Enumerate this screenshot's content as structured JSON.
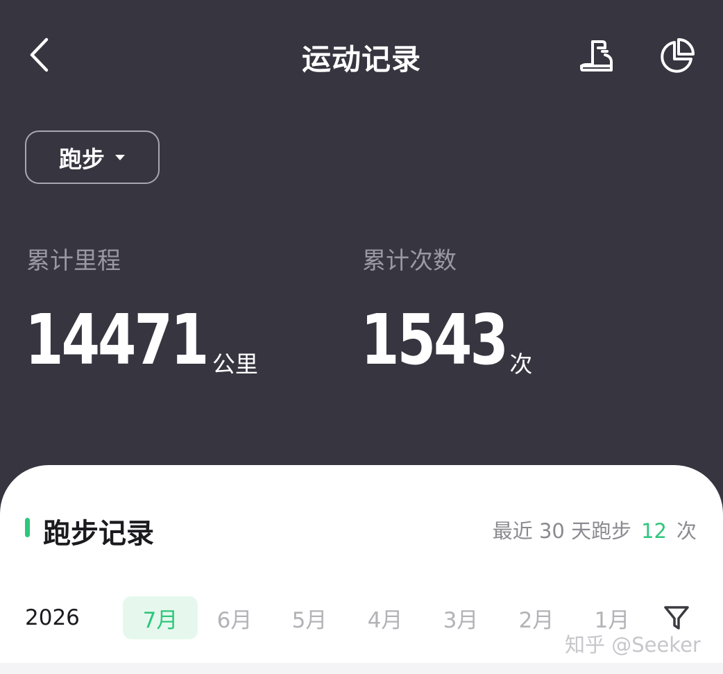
{
  "header": {
    "title": "运动记录",
    "back_icon": "back-chevron-icon",
    "shoe_icon": "running-shoe-icon",
    "stats_icon": "pie-chart-icon"
  },
  "sport_selector": {
    "selected": "跑步",
    "icon": "caret-down-icon"
  },
  "summary": {
    "distance": {
      "label": "累计里程",
      "value": "14471",
      "unit": "公里"
    },
    "count": {
      "label": "累计次数",
      "value": "1543",
      "unit": "次"
    }
  },
  "records": {
    "title": "跑步记录",
    "recent_prefix": "最近 30 天跑步",
    "recent_count": "12",
    "recent_suffix": "次",
    "year": "2026",
    "months": [
      "7月",
      "6月",
      "5月",
      "4月",
      "3月",
      "2月",
      "1月"
    ],
    "selected_month": "7月",
    "filter_icon": "filter-icon"
  },
  "watermark": "知乎 @Seeker",
  "colors": {
    "background": "#363540",
    "accent": "#2fc67c",
    "sheet": "#ffffff"
  }
}
